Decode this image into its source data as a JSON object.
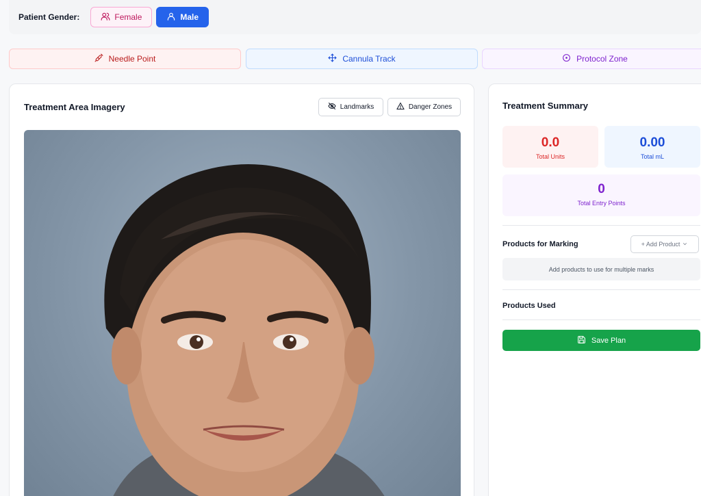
{
  "gender": {
    "label": "Patient Gender:",
    "options": [
      {
        "label": "Female",
        "icon": "users-icon",
        "selected": false
      },
      {
        "label": "Male",
        "icon": "user-icon",
        "selected": true
      }
    ]
  },
  "tools": [
    {
      "label": "Needle Point",
      "icon": "syringe-icon",
      "color": "#b91c1c"
    },
    {
      "label": "Cannula Track",
      "icon": "move-icon",
      "color": "#1d4ed8"
    },
    {
      "label": "Protocol Zone",
      "icon": "target-circle-icon",
      "color": "#7e22ce"
    }
  ],
  "imagery": {
    "title": "Treatment Area Imagery",
    "landmarks_label": "Landmarks",
    "danger_zones_label": "Danger Zones"
  },
  "summary": {
    "title": "Treatment Summary",
    "total_units": {
      "value": "0.0",
      "label": "Total Units"
    },
    "total_ml": {
      "value": "0.00",
      "label": "Total mL"
    },
    "total_entry_points": {
      "value": "0",
      "label": "Total Entry Points"
    },
    "products_marking_title": "Products for Marking",
    "add_product_label": "+ Add Product",
    "empty_products_text": "Add products to use for multiple marks",
    "products_used_title": "Products Used",
    "save_label": "Save Plan"
  },
  "colors": {
    "male_button": "#2563eb",
    "save_button": "#16a34a",
    "units": "#dc2626",
    "ml": "#1d4ed8",
    "entry": "#7e22ce"
  }
}
